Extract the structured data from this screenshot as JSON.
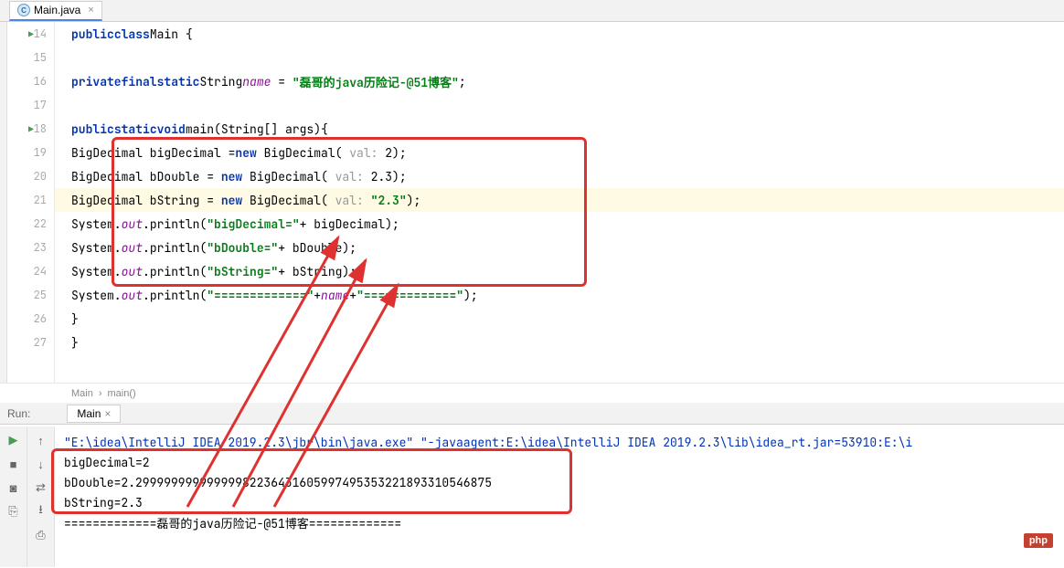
{
  "tab": {
    "label": "Main.java",
    "icon_letter": "C"
  },
  "gutter": {
    "lines": [
      "14",
      "15",
      "16",
      "17",
      "18",
      "19",
      "20",
      "21",
      "22",
      "23",
      "24",
      "25",
      "26",
      "27"
    ],
    "run_markers": [
      14,
      18
    ]
  },
  "code": {
    "l14": {
      "kw1": "public",
      "kw2": "class",
      "cls": "Main {"
    },
    "l16": {
      "kw1": "private",
      "kw2": "final",
      "kw3": "static",
      "type": "String",
      "name": "name",
      "eq": " = ",
      "str": "\"磊哥的java历险记-@51博客\"",
      "end": ";"
    },
    "l18": {
      "kw1": "public",
      "kw2": "static",
      "kw3": "void",
      "sig": "main(String[] args){"
    },
    "l19": {
      "pre": "BigDecimal bigDecimal =",
      "kw": "new",
      "call": " BigDecimal(",
      "hint": " val: ",
      "arg": "2",
      "end": ");"
    },
    "l20": {
      "pre": "BigDecimal bDouble = ",
      "kw": "new",
      "call": " BigDecimal(",
      "hint": " val: ",
      "arg": "2.3",
      "end": ");"
    },
    "l21": {
      "pre": "BigDecimal bString = ",
      "kw": "new",
      "call": " BigDecimal(",
      "hint": " val: ",
      "str": "\"2.3\"",
      "end": ");"
    },
    "l22": {
      "pre": "System.",
      "out": "out",
      "mid": ".println(",
      "str": "\"bigDecimal=\"",
      "post": "+ bigDecimal);"
    },
    "l23": {
      "pre": "System.",
      "out": "out",
      "mid": ".println(",
      "str": "\"bDouble=\"",
      "post": "+ bDouble);"
    },
    "l24": {
      "pre": "System.",
      "out": "out",
      "mid": ".println(",
      "str": "\"bString=\"",
      "post": "+ bString);"
    },
    "l25": {
      "pre": "System.",
      "out": "out",
      "mid": ".println(",
      "str1": "\"=============\"",
      "plus1": "+",
      "name": "name",
      "plus2": "+",
      "str2": "\"=============\"",
      "end": ");"
    },
    "l26": "}",
    "l27": "}"
  },
  "breadcrumb": {
    "a": "Main",
    "sep": "›",
    "b": "main()"
  },
  "run": {
    "label": "Run:",
    "tab": "Main",
    "cmd": "\"E:\\idea\\IntelliJ IDEA 2019.2.3\\jbr\\bin\\java.exe\" \"-javaagent:E:\\idea\\IntelliJ IDEA 2019.2.3\\lib\\idea_rt.jar=53910:E:\\i",
    "out1": "bigDecimal=2",
    "out2": "bDouble=2.29999999999999982236431605997495353221893310546875",
    "out3": "bString=2.3",
    "out4": "=============磊哥的java历险记-@51博客============="
  },
  "badge": "php"
}
